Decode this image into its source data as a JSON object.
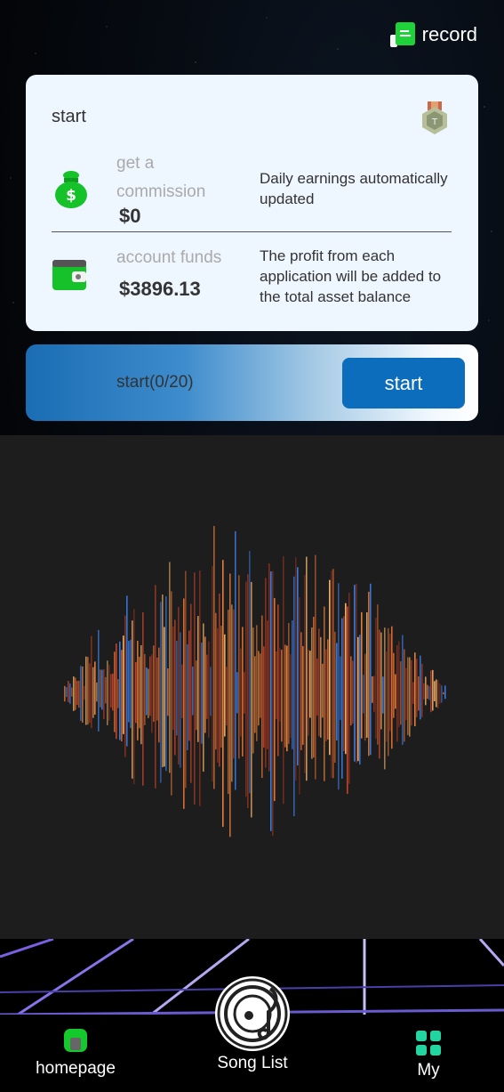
{
  "header": {
    "record_label": "record"
  },
  "summary_card": {
    "title": "start",
    "commission": {
      "label": "get a commission",
      "currency": "$",
      "amount": "0",
      "description": "Daily earnings automatically updated"
    },
    "funds": {
      "label": "account funds",
      "currency": "$",
      "amount": "3896.13",
      "description": "The profit from each application will be added to the total asset balance"
    }
  },
  "start_card": {
    "progress_label": "start(0/20)",
    "button_label": "start"
  },
  "nav": {
    "items": [
      {
        "label": "homepage",
        "icon": "home-icon"
      },
      {
        "label": "Song List",
        "icon": "music-disc-icon"
      },
      {
        "label": "My",
        "icon": "grid-icon"
      }
    ]
  },
  "colors": {
    "accent_green": "#1fd23a",
    "primary_blue": "#0b6dbb",
    "card_bg": "#eef6ff",
    "nav_my_icon": "#22d4a0"
  }
}
